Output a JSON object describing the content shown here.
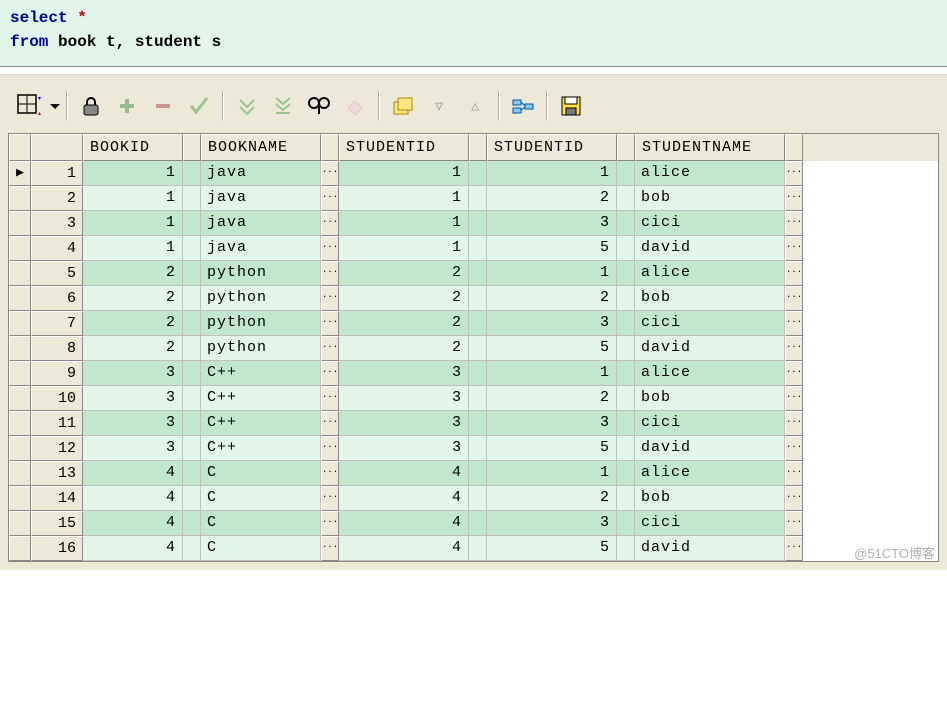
{
  "sql": {
    "kw1": "select",
    "op1": "*",
    "kw2": "from",
    "rest": " book t, student s"
  },
  "columns": [
    "BOOKID",
    "BOOKNAME",
    "STUDENTID",
    "STUDENTID",
    "STUDENTNAME"
  ],
  "rows": [
    {
      "n": 1,
      "bookid": 1,
      "bookname": "java",
      "sid1": 1,
      "sid2": 1,
      "sname": "alice",
      "cur": true
    },
    {
      "n": 2,
      "bookid": 1,
      "bookname": "java",
      "sid1": 1,
      "sid2": 2,
      "sname": "bob"
    },
    {
      "n": 3,
      "bookid": 1,
      "bookname": "java",
      "sid1": 1,
      "sid2": 3,
      "sname": "cici"
    },
    {
      "n": 4,
      "bookid": 1,
      "bookname": "java",
      "sid1": 1,
      "sid2": 5,
      "sname": "david"
    },
    {
      "n": 5,
      "bookid": 2,
      "bookname": "python",
      "sid1": 2,
      "sid2": 1,
      "sname": "alice"
    },
    {
      "n": 6,
      "bookid": 2,
      "bookname": "python",
      "sid1": 2,
      "sid2": 2,
      "sname": "bob"
    },
    {
      "n": 7,
      "bookid": 2,
      "bookname": "python",
      "sid1": 2,
      "sid2": 3,
      "sname": "cici"
    },
    {
      "n": 8,
      "bookid": 2,
      "bookname": "python",
      "sid1": 2,
      "sid2": 5,
      "sname": "david"
    },
    {
      "n": 9,
      "bookid": 3,
      "bookname": "C++",
      "sid1": 3,
      "sid2": 1,
      "sname": "alice"
    },
    {
      "n": 10,
      "bookid": 3,
      "bookname": "C++",
      "sid1": 3,
      "sid2": 2,
      "sname": "bob"
    },
    {
      "n": 11,
      "bookid": 3,
      "bookname": "C++",
      "sid1": 3,
      "sid2": 3,
      "sname": "cici"
    },
    {
      "n": 12,
      "bookid": 3,
      "bookname": "C++",
      "sid1": 3,
      "sid2": 5,
      "sname": "david"
    },
    {
      "n": 13,
      "bookid": 4,
      "bookname": "C",
      "sid1": 4,
      "sid2": 1,
      "sname": "alice"
    },
    {
      "n": 14,
      "bookid": 4,
      "bookname": "C",
      "sid1": 4,
      "sid2": 2,
      "sname": "bob"
    },
    {
      "n": 15,
      "bookid": 4,
      "bookname": "C",
      "sid1": 4,
      "sid2": 3,
      "sname": "cici"
    },
    {
      "n": 16,
      "bookid": 4,
      "bookname": "C",
      "sid1": 4,
      "sid2": 5,
      "sname": "david"
    }
  ],
  "ellipsis": "···",
  "marker": "▶",
  "watermark": "@51CTO博客"
}
